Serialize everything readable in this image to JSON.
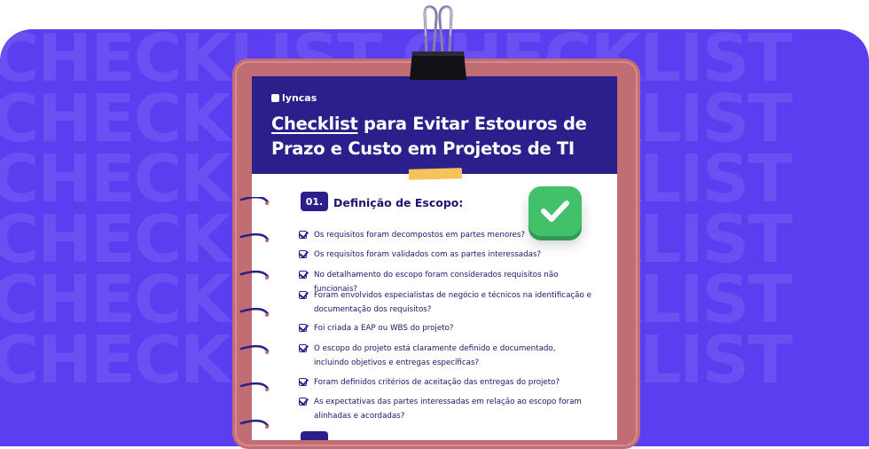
{
  "background": {
    "color": "#5b3ef0",
    "watermark_rows": [
      "CHECKLIST CHECKLIST",
      "CHECKLIST CHECKLIST",
      "CHECKLIST CHECKLIST",
      "CHECKLIST CHECKLIST",
      "CHECKLIST CHECKLIST",
      "CHECKLIST CHECKLIST"
    ]
  },
  "brand": {
    "name": "lyncas"
  },
  "header": {
    "title_highlight": "Checklist",
    "title_rest_line1": " para Evitar Estouros de",
    "title_line2": "Prazo e Custo em Projetos de TI"
  },
  "section": {
    "number": "01.",
    "title": "Definição de Escopo:",
    "items": [
      "Os requisitos foram decompostos em partes menores?",
      "Os requisitos foram validados com as partes interessadas?",
      "No detalhamento do escopo foram considerados requisitos não funcionais?",
      "Foram envolvidos especialistas de negócio e técnicos na identificação e documentação dos requisitos?",
      "Foi criada a EAP ou WBS do projeto?",
      "O escopo do projeto está claramente definido e documentado, incluindo objetivos e entregas específicas?",
      "Foram definidos critérios de aceitação das entregas do projeto?",
      "As expectativas das partes interessadas em relação ao escopo foram alinhadas e acordadas?"
    ]
  },
  "colors": {
    "navy": "#2b1f8c",
    "board": "#c06e73",
    "accent_tape": "#f6c35a",
    "check_green": "#43c06a"
  },
  "icons": {
    "section_badge": "check-3d-icon",
    "item_checkbox": "checkbox-checked-icon",
    "clip": "binder-clip-icon"
  }
}
